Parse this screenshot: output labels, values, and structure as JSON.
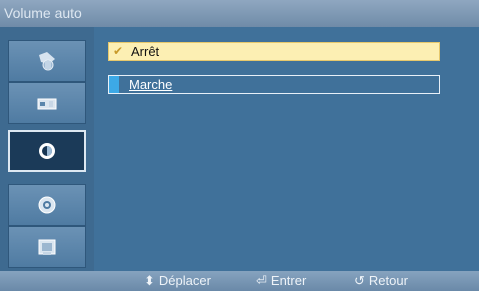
{
  "window": {
    "title": "Volume auto"
  },
  "sidebar": {
    "items": [
      {
        "name": "picture-icon"
      },
      {
        "name": "sound-icon"
      },
      {
        "name": "setup-icon",
        "active": true
      },
      {
        "name": "gear-icon"
      },
      {
        "name": "multiwindow-icon"
      }
    ]
  },
  "options": [
    {
      "label": "Arrêt",
      "checked": true
    },
    {
      "label": "Marche",
      "checked": false
    }
  ],
  "footer": {
    "move": {
      "icon": "updown-icon",
      "label": "Déplacer"
    },
    "enter": {
      "icon": "enter-icon",
      "label": "Entrer"
    },
    "return": {
      "icon": "return-icon",
      "label": "Retour"
    }
  },
  "colors": {
    "accent_selected": "#fcefb3",
    "marker": "#3da9e6",
    "background": "#40719a"
  }
}
